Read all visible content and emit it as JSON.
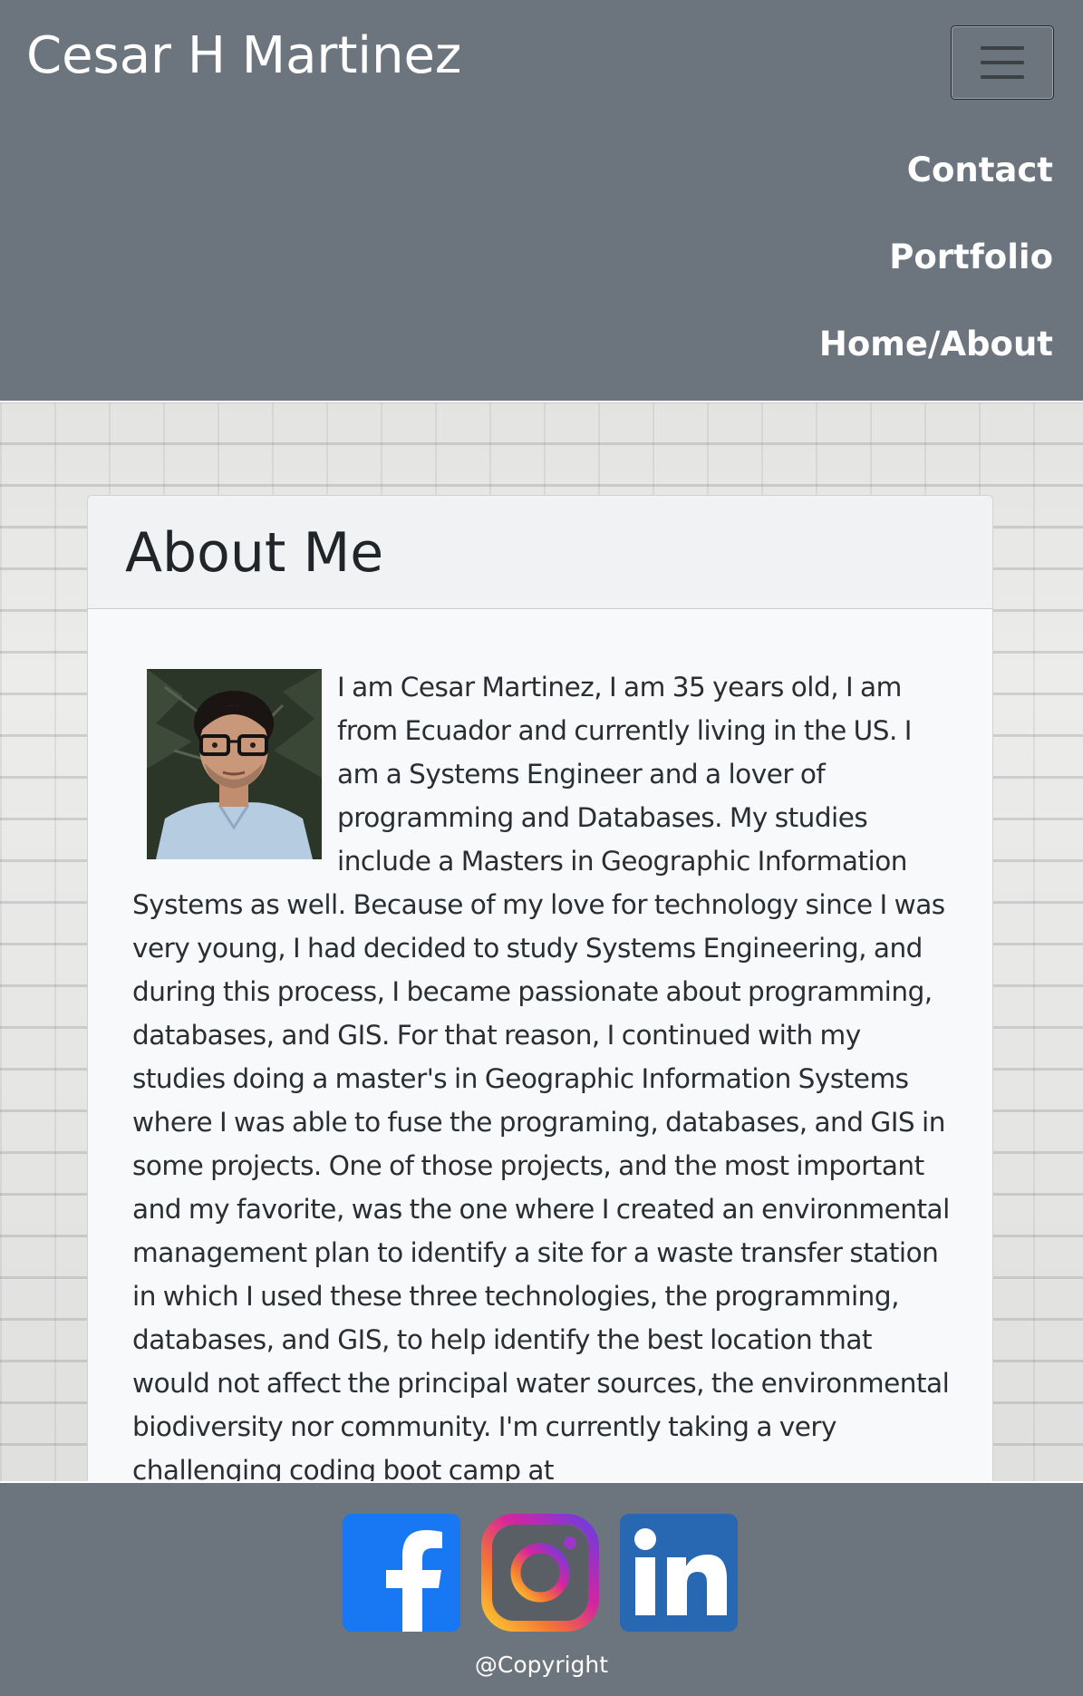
{
  "navbar": {
    "brand": "Cesar H Martinez",
    "toggler_icon": "hamburger-menu-icon",
    "links": [
      {
        "label": "Contact"
      },
      {
        "label": "Portfolio"
      },
      {
        "label": "Home/About"
      }
    ],
    "background_color": "#6c757d"
  },
  "about": {
    "title": "About Me",
    "photo_icon": "profile-photo",
    "text": "I am Cesar Martinez, I am 35 years old, I am from Ecuador and currently living in the US. I am a Systems Engineer and a lover of programming and Databases. My studies include a Masters in Geographic Information Systems as well. Because of my love for technology since I was very young, I had decided to study Systems Engineering, and during this process, I became passionate about programming, databases, and GIS. For that reason, I continued with my studies doing a master's in Geographic Information Systems where I was able to fuse the programing, databases, and GIS in some projects. One of those projects, and the most important and my favorite, was the one where I created an environmental management plan to identify a site for a waste transfer station in which I used these three technologies, the programming, databases, and GIS, to help identify the best location that would not affect the principal water sources, the environmental biodiversity nor community. I'm currently taking a very challenging coding boot camp at"
  },
  "footer": {
    "social": [
      {
        "icon": "facebook-icon",
        "color": "#1877f2"
      },
      {
        "icon": "instagram-icon",
        "color": "#d6249f"
      },
      {
        "icon": "linkedin-icon",
        "color": "#2867b2"
      }
    ],
    "copyright": "@Copyright",
    "background_color": "#6c757d"
  }
}
